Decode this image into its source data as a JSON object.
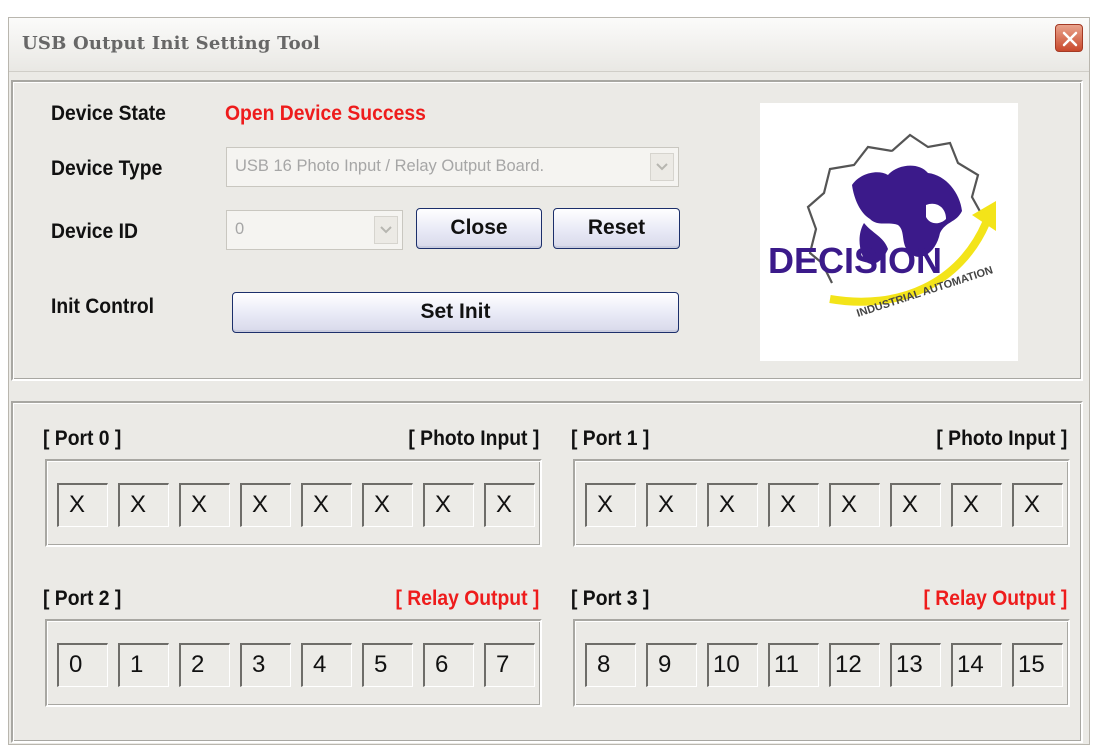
{
  "window": {
    "title": "USB Output Init Setting Tool"
  },
  "device": {
    "state_label": "Device State",
    "state_value": "Open Device Success",
    "type_label": "Device Type",
    "type_value": "USB 16 Photo Input / Relay Output Board.",
    "id_label": "Device ID",
    "id_value": "0",
    "init_label": "Init Control"
  },
  "buttons": {
    "close": "Close",
    "reset": "Reset",
    "set_init": "Set Init"
  },
  "logo": {
    "brand": "DECISION",
    "tagline": "INDUSTRIAL AUTOMATION"
  },
  "ports": [
    {
      "label": "[ Port 0 ]",
      "type": "[ Photo  Input ]",
      "type_color": "#111111",
      "cells": [
        "X",
        "X",
        "X",
        "X",
        "X",
        "X",
        "X",
        "X"
      ]
    },
    {
      "label": "[ Port 1 ]",
      "type": "[ Photo  Input ]",
      "type_color": "#111111",
      "cells": [
        "X",
        "X",
        "X",
        "X",
        "X",
        "X",
        "X",
        "X"
      ]
    },
    {
      "label": "[ Port 2 ]",
      "type": "[ Relay Output ]",
      "type_color": "#ee1c1c",
      "cells": [
        "0",
        "1",
        "2",
        "3",
        "4",
        "5",
        "6",
        "7"
      ]
    },
    {
      "label": "[ Port 3 ]",
      "type": "[ Relay Output ]",
      "type_color": "#ee1c1c",
      "cells": [
        "8",
        "9",
        "10",
        "11",
        "12",
        "13",
        "14",
        "15"
      ]
    }
  ]
}
